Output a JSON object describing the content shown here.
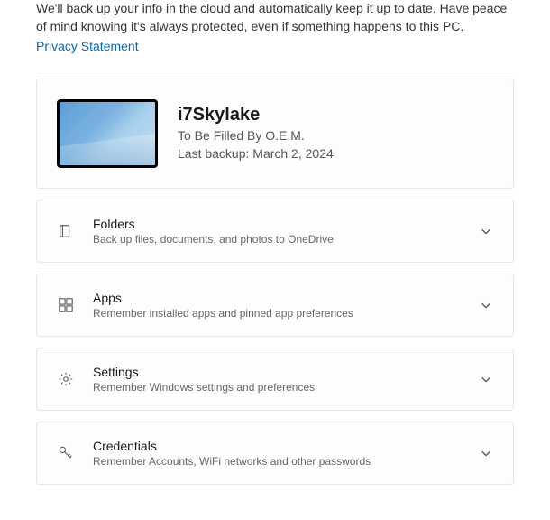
{
  "intro": "We'll back up your info in the cloud and automatically keep it up to date. Have peace of mind knowing it's always protected, even if something happens to this PC.",
  "privacy_link": "Privacy Statement",
  "device": {
    "name": "i7Skylake",
    "oem": "To Be Filled By O.E.M.",
    "last_backup": "Last backup: March 2, 2024"
  },
  "rows": [
    {
      "title": "Folders",
      "desc": "Back up files, documents, and photos to OneDrive"
    },
    {
      "title": "Apps",
      "desc": "Remember installed apps and pinned app preferences"
    },
    {
      "title": "Settings",
      "desc": "Remember Windows settings and preferences"
    },
    {
      "title": "Credentials",
      "desc": "Remember Accounts, WiFi networks and other passwords"
    }
  ]
}
